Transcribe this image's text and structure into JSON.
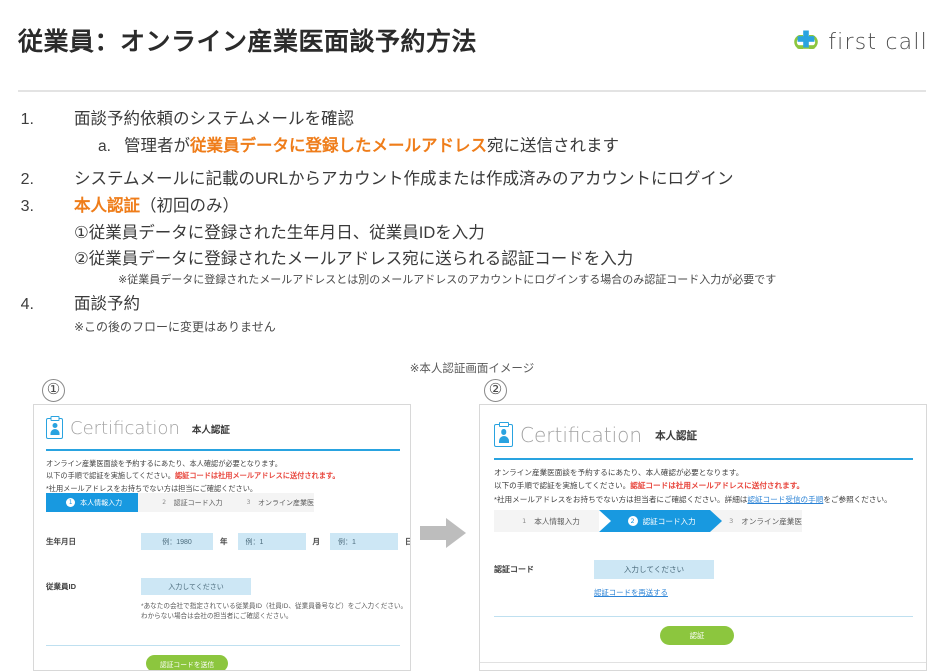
{
  "header": {
    "title": "従業員：オンライン産業医面談予約方法",
    "brand": "first call",
    "brand_blue": "#29a3e0",
    "brand_green": "#8cc63e"
  },
  "accent": {
    "orange": "#ef7d1a",
    "blue": "#1899e0",
    "red": "#e8453c",
    "green": "#8cc63e",
    "link": "#2b83d6"
  },
  "steps": [
    {
      "num": "1.",
      "text": "面談予約依頼のシステムメールを確認",
      "sub": {
        "marker": "a.",
        "pre": "管理者が",
        "hl": "従業員データに登録したメールアドレス",
        "post": "宛に送信されます"
      }
    },
    {
      "num": "2.",
      "text": "システムメールに記載のURLからアカウント作成または作成済みのアカウントにログイン"
    },
    {
      "num": "3.",
      "hl": "本人認証",
      "text": "（初回のみ）",
      "lines": [
        "①従業員データに登録された生年月日、従業員IDを入力",
        "②従業員データに登録されたメールアドレス宛に送られる認証コードを入力"
      ],
      "note": "※従業員データに登録されたメールアドレスとは別のメールアドレスのアカウントにログインする場合のみ認証コード入力が必要です"
    },
    {
      "num": "4.",
      "text": "面談予約",
      "note": "※この後のフローに変更はありません"
    }
  ],
  "image_caption": "※本人認証画面イメージ",
  "panels": {
    "left": {
      "label": "①",
      "card": {
        "logo_word": "Certification",
        "logo_jp": "本人認証",
        "lead": [
          {
            "text": "オンライン産業医面談を予約するにあたり、本人確認が必要となります。"
          },
          {
            "pre": "以下の手順で認証を実施してください。",
            "red": "認証コードは社用メールアドレスに送付されます。"
          },
          {
            "text": "*社用メールアドレスをお持ちでない方は担当にご確認ください。"
          }
        ],
        "steps": [
          {
            "n": "1",
            "label": "本人情報入力",
            "active": true
          },
          {
            "n": "2",
            "label": "認証コード入力",
            "active": false
          },
          {
            "n": "3",
            "label": "オンライン産業医",
            "active": false
          }
        ],
        "birth_label": "生年月日",
        "birth_fields": [
          {
            "placeholder": "例：1980",
            "unit": "年"
          },
          {
            "placeholder": "例：1",
            "unit": "月"
          },
          {
            "placeholder": "例：1",
            "unit": "日"
          }
        ],
        "empid_label": "従業員ID",
        "empid_placeholder": "入力してください",
        "empid_hints": [
          "*あなたの会社で指定されている従業員ID（社員ID、従業員番号など）をご入力ください。",
          "わからない場合は会社の担当者にご確認ください。"
        ],
        "submit_label": "認証コードを送信"
      }
    },
    "right": {
      "label": "②",
      "card": {
        "logo_word": "Certification",
        "logo_jp": "本人認証",
        "lead": [
          {
            "text": "オンライン産業医面談を予約するにあたり、本人確認が必要となります。"
          },
          {
            "pre": "以下の手順で認証を実施してください。",
            "red": "認証コードは社用メールアドレスに送付されます。"
          },
          {
            "pre": "*社用メールアドレスをお持ちでない方は担当者にご確認ください。詳細は",
            "link": "認証コード受信の手順",
            "post": "をご参照ください。"
          }
        ],
        "steps": [
          {
            "n": "1",
            "label": "本人情報入力",
            "active": false
          },
          {
            "n": "2",
            "label": "認証コード入力",
            "active": true
          },
          {
            "n": "3",
            "label": "オンライン産業医",
            "active": false
          }
        ],
        "code_label": "認証コード",
        "code_placeholder": "入力してください",
        "resend_link": "認証コードを再送する",
        "submit_label": "認証"
      }
    }
  },
  "flow_arrow_icon": "right-arrow-icon"
}
